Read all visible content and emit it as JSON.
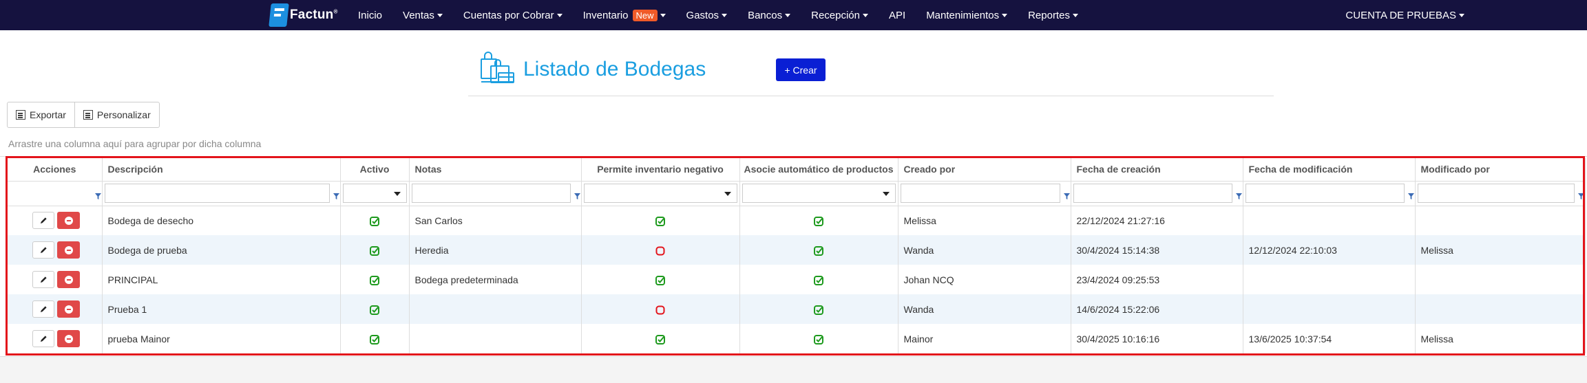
{
  "nav": {
    "brand": "Factun",
    "brand_mark": "®",
    "items": [
      {
        "label": "Inicio",
        "caret": false
      },
      {
        "label": "Ventas",
        "caret": true
      },
      {
        "label": "Cuentas por Cobrar",
        "caret": true
      },
      {
        "label": "Inventario",
        "caret": true,
        "badge": "New"
      },
      {
        "label": "Gastos",
        "caret": true
      },
      {
        "label": "Bancos",
        "caret": true
      },
      {
        "label": "Recepción",
        "caret": true
      },
      {
        "label": "API",
        "caret": false
      },
      {
        "label": "Mantenimientos",
        "caret": true
      },
      {
        "label": "Reportes",
        "caret": true
      }
    ],
    "account": "CUENTA DE PRUEBAS"
  },
  "header": {
    "title": "Listado de Bodegas",
    "create_label": "+ Crear",
    "icon": "warehouse-boxes-icon"
  },
  "toolbar": {
    "export_label": "Exportar",
    "customize_label": "Personalizar"
  },
  "grid": {
    "group_hint": "Arrastre una columna aquí para agrupar por dicha columna",
    "columns": [
      "Acciones",
      "Descripción",
      "Activo",
      "Notas",
      "Permite inventario negativo",
      "Asocie automático de productos",
      "Creado por",
      "Fecha de creación",
      "Fecha de modificación",
      "Modificado por"
    ],
    "rows": [
      {
        "descripcion": "Bodega de desecho",
        "activo": true,
        "notas": "San Carlos",
        "inv_negativo": true,
        "asocie": true,
        "creado_por": "Melissa",
        "fecha_creacion": "22/12/2024 21:27:16",
        "fecha_mod": "",
        "mod_por": ""
      },
      {
        "descripcion": "Bodega de prueba",
        "activo": true,
        "notas": "Heredia",
        "inv_negativo": false,
        "asocie": true,
        "creado_por": "Wanda",
        "fecha_creacion": "30/4/2024 15:14:38",
        "fecha_mod": "12/12/2024 22:10:03",
        "mod_por": "Melissa"
      },
      {
        "descripcion": "PRINCIPAL",
        "activo": true,
        "notas": "Bodega predeterminada",
        "inv_negativo": true,
        "asocie": true,
        "creado_por": "Johan NCQ",
        "fecha_creacion": "23/4/2024 09:25:53",
        "fecha_mod": "",
        "mod_por": ""
      },
      {
        "descripcion": "Prueba 1",
        "activo": true,
        "notas": "",
        "inv_negativo": false,
        "asocie": true,
        "creado_por": "Wanda",
        "fecha_creacion": "14/6/2024 15:22:06",
        "fecha_mod": "",
        "mod_por": ""
      },
      {
        "descripcion": "prueba Mainor",
        "activo": true,
        "notas": "",
        "inv_negativo": true,
        "asocie": true,
        "creado_por": "Mainor",
        "fecha_creacion": "30/4/2025 10:16:16",
        "fecha_mod": "13/6/2025 10:37:54",
        "mod_por": "Melissa"
      }
    ]
  },
  "colors": {
    "navbar": "#15123f",
    "title": "#1a9ee0",
    "create_button": "#0a1fd4",
    "delete_button": "#e04848",
    "check_true": "#1e9a1e",
    "check_false": "#e3141b",
    "highlight_frame": "#e3141b"
  }
}
